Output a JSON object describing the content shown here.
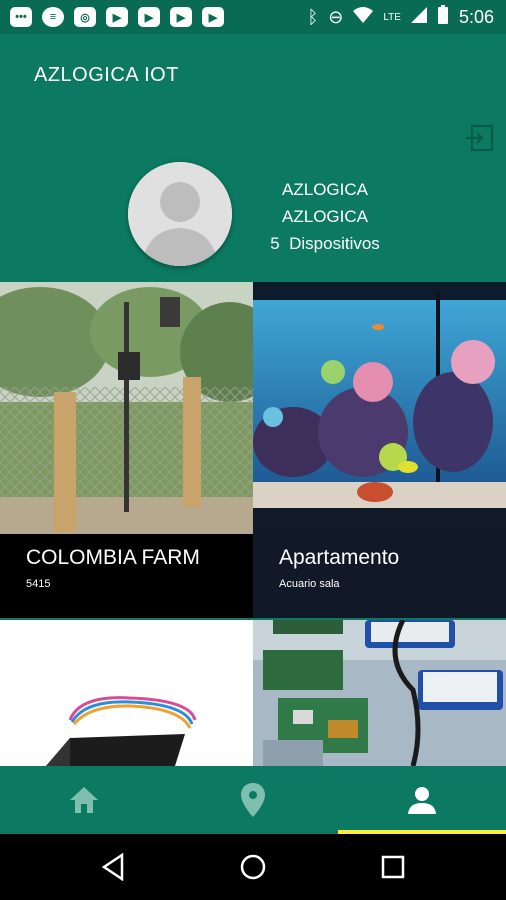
{
  "status_bar": {
    "time": "5:06",
    "network": "LTE",
    "left_icons": [
      "messages-icon",
      "spotify-icon",
      "instagram-icon",
      "youtube-icon",
      "youtube-icon",
      "youtube-icon",
      "youtube-icon"
    ],
    "right_icons": [
      "bluetooth-icon",
      "dnd-icon",
      "wifi-icon",
      "signal-icon",
      "battery-icon"
    ]
  },
  "app_bar": {
    "title": "AZLOGICA IOT"
  },
  "profile": {
    "line1": "AZLOGICA",
    "line2": "AZLOGICA",
    "device_count": "5",
    "devices_label": "Dispositivos"
  },
  "cards": [
    {
      "title": "COLOMBIA FARM",
      "subtitle": "5415",
      "image": "farm-photo"
    },
    {
      "title": "Apartamento",
      "subtitle": "Acuario sala",
      "image": "aquarium-photo"
    },
    {
      "title": "",
      "subtitle": "",
      "image": "sensor-device-photo"
    },
    {
      "title": "",
      "subtitle": "",
      "image": "circuit-boards-photo"
    }
  ],
  "bottom_nav": {
    "items": [
      "home-icon",
      "location-icon",
      "person-icon"
    ],
    "active": "person-icon",
    "colors": {
      "active": "#ffffff",
      "inactive": "#7fbfae",
      "indicator": "#ffeb3b"
    }
  },
  "colors": {
    "primary": "#0c7a62",
    "status": "#0a6b55",
    "caption_dark": "#111827"
  }
}
